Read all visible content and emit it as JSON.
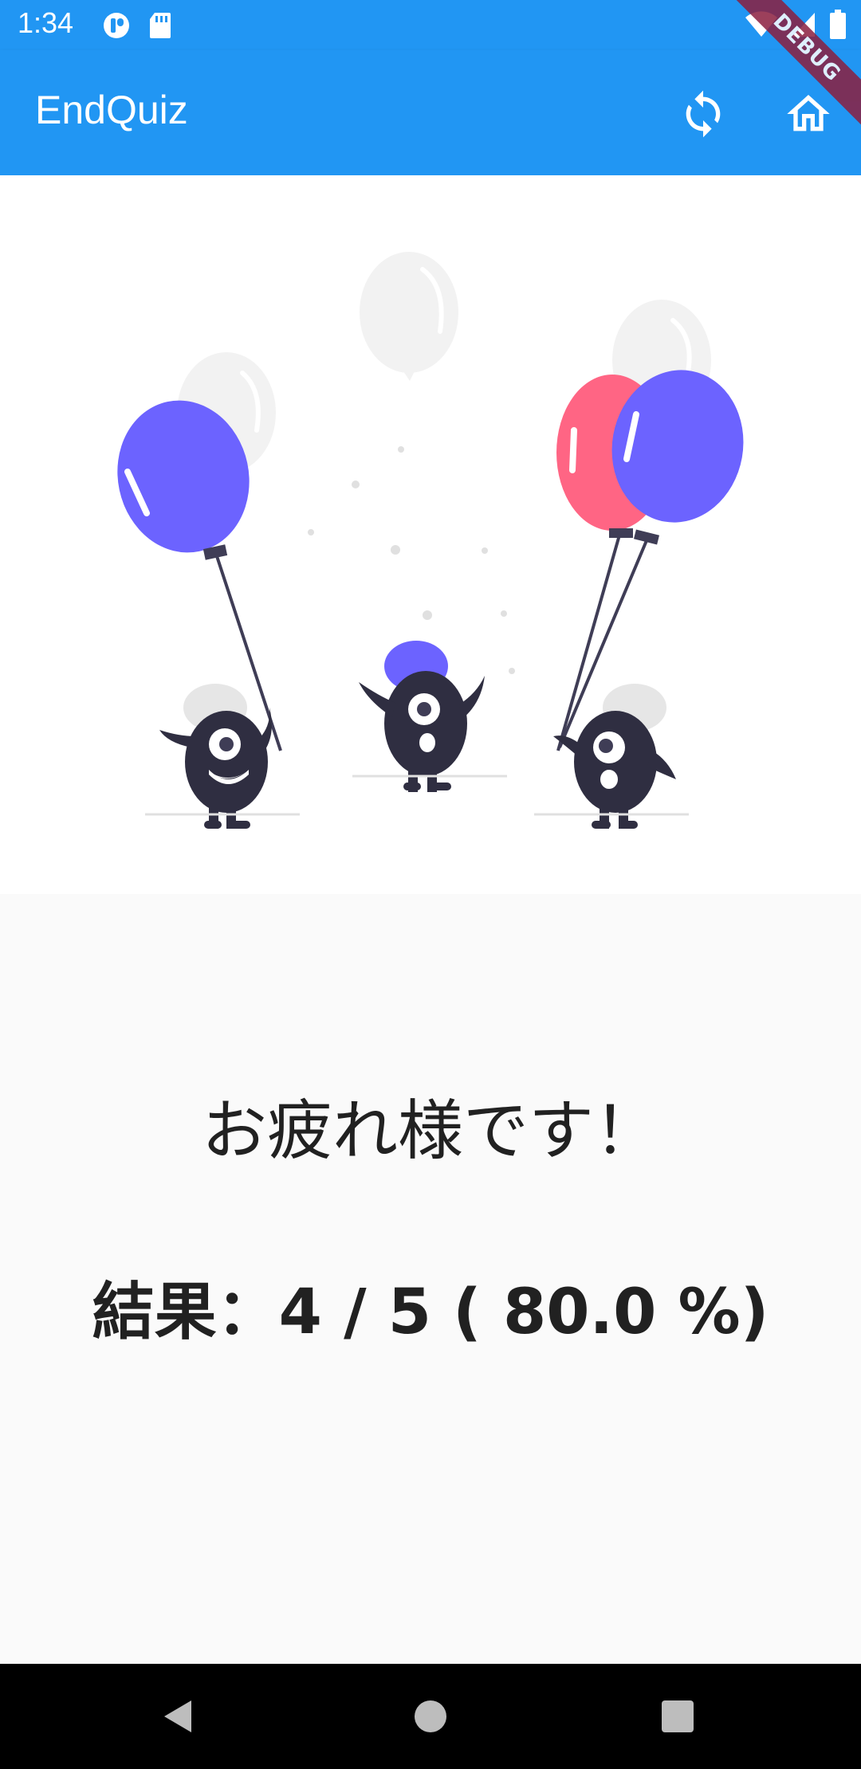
{
  "status_bar": {
    "time": "1:34",
    "left_icons": [
      "notification-app-icon",
      "sd-card-icon"
    ],
    "right_icons": [
      "wifi-icon",
      "signal-icon",
      "battery-icon"
    ]
  },
  "app_bar": {
    "title": "EndQuiz",
    "actions": [
      "refresh-icon",
      "home-icon"
    ],
    "color": "#2196f3"
  },
  "debug_banner": "DEBUG",
  "illustration": {
    "colors": {
      "balloon_blue": "#6c63ff",
      "balloon_pink": "#ff6584",
      "balloon_grey": "#f2f2f2",
      "monster": "#2f2e41",
      "hat_grey": "#e6e6e6"
    }
  },
  "result": {
    "message": "お疲れ様です！",
    "label": "結果：",
    "score_text": "4 / 5 ( 80.0 %)",
    "score": 4,
    "total": 5,
    "percent": 80.0
  },
  "nav_bar": {
    "buttons": [
      "back-icon",
      "home-circle-icon",
      "recent-apps-icon"
    ]
  }
}
